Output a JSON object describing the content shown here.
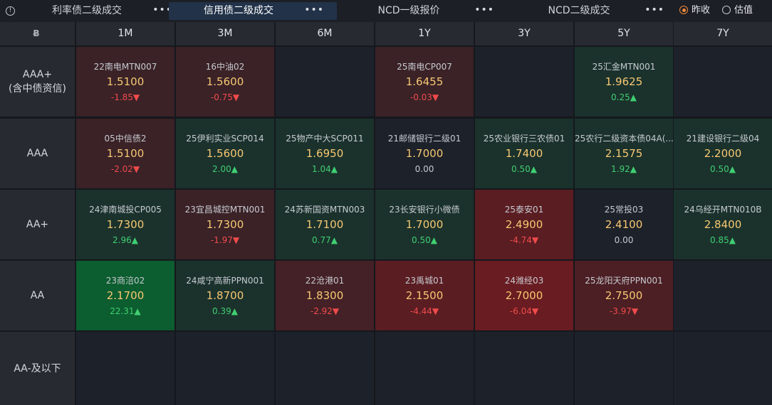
{
  "tabs": [
    {
      "label": "利率债二级成交",
      "more": "•••",
      "active": false
    },
    {
      "label": "信用债二级成交",
      "more": "•••",
      "active": true
    },
    {
      "label": "NCD一级报价",
      "more": "•••",
      "active": false
    },
    {
      "label": "NCD二级成交",
      "more": "•••",
      "active": false
    }
  ],
  "radio": [
    {
      "label": "昨收",
      "checked": true
    },
    {
      "label": "估值",
      "checked": false
    }
  ],
  "columns": [
    "1M",
    "3M",
    "6M",
    "1Y",
    "3Y",
    "5Y",
    "7Y"
  ],
  "rows": [
    {
      "label": "AAA+\n(含中债资信)",
      "cells": [
        {
          "name": "22南电MTN007",
          "price": "1.5100",
          "chg": "-1.85▼",
          "dir": "down",
          "bg": "#3a2227"
        },
        {
          "name": "16中油02",
          "price": "1.5600",
          "chg": "-0.75▼",
          "dir": "down",
          "bg": "#3a2227"
        },
        null,
        {
          "name": "25南电CP007",
          "price": "1.6455",
          "chg": "-0.03▼",
          "dir": "down",
          "bg": "#3a2227"
        },
        null,
        {
          "name": "25汇金MTN001",
          "price": "1.9625",
          "chg": "0.25▲",
          "dir": "up",
          "bg": "#1b322c"
        },
        null
      ]
    },
    {
      "label": "AAA",
      "cells": [
        {
          "name": "05中信债2",
          "price": "1.5100",
          "chg": "-2.02▼",
          "dir": "down",
          "bg": "#3a2227"
        },
        {
          "name": "25伊利实业SCP014",
          "price": "1.5600",
          "chg": "2.00▲",
          "dir": "up",
          "bg": "#1b322c"
        },
        {
          "name": "25物产中大SCP011",
          "price": "1.6950",
          "chg": "1.04▲",
          "dir": "up",
          "bg": "#1b322c"
        },
        {
          "name": "21邮储银行二级01",
          "price": "1.7000",
          "chg": "0.00",
          "dir": "flat",
          "bg": "#1d2129"
        },
        {
          "name": "25农业银行三农债01",
          "price": "1.7400",
          "chg": "0.50▲",
          "dir": "up",
          "bg": "#1b322c"
        },
        {
          "name": "25农行二级资本债04A(...",
          "price": "2.1575",
          "chg": "1.92▲",
          "dir": "up",
          "bg": "#1b322c"
        },
        {
          "name": "21建设银行二级04",
          "price": "2.2000",
          "chg": "0.50▲",
          "dir": "up",
          "bg": "#1b322c"
        }
      ]
    },
    {
      "label": "AA+",
      "cells": [
        {
          "name": "24津南城投CP005",
          "price": "1.7300",
          "chg": "2.96▲",
          "dir": "up",
          "bg": "#1b322c"
        },
        {
          "name": "23宜昌城控MTN001",
          "price": "1.7300",
          "chg": "-1.97▼",
          "dir": "down",
          "bg": "#3a2227"
        },
        {
          "name": "24苏新国资MTN003",
          "price": "1.7100",
          "chg": "0.77▲",
          "dir": "up",
          "bg": "#1b322c"
        },
        {
          "name": "23长安银行小微债",
          "price": "1.7000",
          "chg": "0.50▲",
          "dir": "up",
          "bg": "#1b322c"
        },
        {
          "name": "25泰安01",
          "price": "2.4900",
          "chg": "-4.74▼",
          "dir": "down",
          "bg": "#5a1d22"
        },
        {
          "name": "25常投03",
          "price": "2.4100",
          "chg": "0.00",
          "dir": "flat",
          "bg": "#1d2129"
        },
        {
          "name": "24乌经开MTN010B",
          "price": "2.8400",
          "chg": "0.85▲",
          "dir": "up",
          "bg": "#1b322c"
        }
      ]
    },
    {
      "label": "AA",
      "cells": [
        {
          "name": "23商涪02",
          "price": "2.1700",
          "chg": "22.31▲",
          "dir": "up",
          "bg": "#0c5d2f"
        },
        {
          "name": "24咸宁高新PPN001",
          "price": "1.8700",
          "chg": "0.39▲",
          "dir": "up",
          "bg": "#1b322c"
        },
        {
          "name": "22沧港01",
          "price": "1.8300",
          "chg": "-2.92▼",
          "dir": "down",
          "bg": "#442126"
        },
        {
          "name": "23禹城01",
          "price": "2.1500",
          "chg": "-4.44▼",
          "dir": "down",
          "bg": "#5a1d22"
        },
        {
          "name": "24潍经03",
          "price": "2.7000",
          "chg": "-6.04▼",
          "dir": "down",
          "bg": "#691c21"
        },
        {
          "name": "25龙阳天府PPN001",
          "price": "2.7500",
          "chg": "-3.97▼",
          "dir": "down",
          "bg": "#4c1f24"
        },
        null
      ]
    },
    {
      "label": "AA-及以下",
      "cells": [
        null,
        null,
        null,
        null,
        null,
        null,
        null
      ]
    }
  ],
  "colors": {
    "header_bg": "#272a31",
    "empty_cell": "#1d2129",
    "price": "#f7c873",
    "up": "#3fcf72",
    "down": "#f04b4b",
    "accent": "#f08a3c",
    "active_tab": "#213249"
  }
}
